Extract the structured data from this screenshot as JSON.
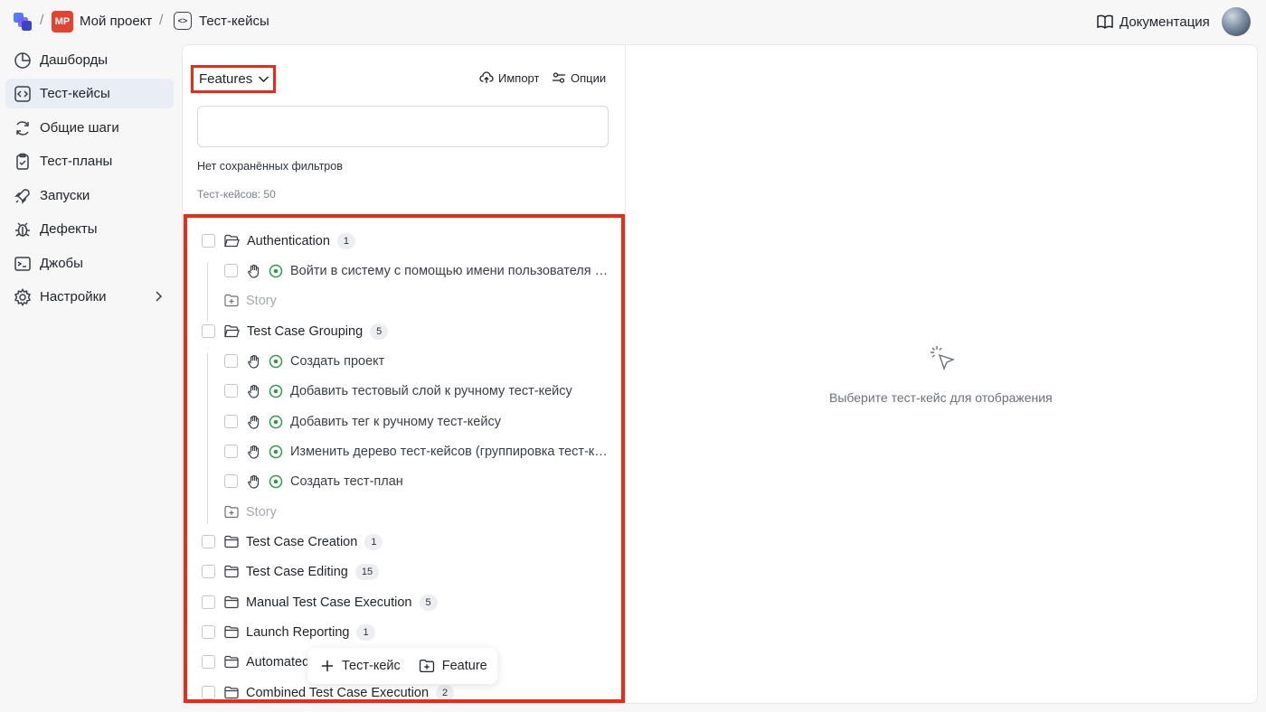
{
  "breadcrumb": {
    "separator": "/",
    "project_badge": "MP",
    "project_name": "Мой проект",
    "page_name": "Тест-кейсы"
  },
  "header": {
    "docs_label": "Документация"
  },
  "sidebar": {
    "items": [
      {
        "label": "Дашборды",
        "icon": "pie-chart-icon"
      },
      {
        "label": "Тест-кейсы",
        "icon": "code-square-icon",
        "active": true
      },
      {
        "label": "Общие шаги",
        "icon": "refresh-icon"
      },
      {
        "label": "Тест-планы",
        "icon": "clipboard-check-icon"
      },
      {
        "label": "Запуски",
        "icon": "rocket-icon"
      },
      {
        "label": "Дефекты",
        "icon": "bug-icon"
      },
      {
        "label": "Джобы",
        "icon": "terminal-icon"
      },
      {
        "label": "Настройки",
        "icon": "gear-icon"
      }
    ]
  },
  "panel": {
    "grouping_label": "Features",
    "import_label": "Импорт",
    "options_label": "Опции",
    "no_filters": "Нет сохранённых фильтров",
    "count_label": "Тест-кейсов: 50"
  },
  "tree": [
    {
      "type": "folder",
      "label": "Authentication",
      "count": "1",
      "open": true
    },
    {
      "type": "case",
      "label": "Войти в систему с помощью имени пользователя и пароля"
    },
    {
      "type": "story",
      "label": "Story"
    },
    {
      "type": "folder",
      "label": "Test Case Grouping",
      "count": "5",
      "open": true
    },
    {
      "type": "case",
      "label": "Создать проект"
    },
    {
      "type": "case",
      "label": "Добавить тестовый слой к ручному тест-кейсу"
    },
    {
      "type": "case",
      "label": "Добавить тег к ручному тест-кейсу"
    },
    {
      "type": "case",
      "label": "Изменить дерево тест-кейсов (группировка тест-кейсов)"
    },
    {
      "type": "case",
      "label": "Создать тест-план"
    },
    {
      "type": "story",
      "label": "Story"
    },
    {
      "type": "folder",
      "label": "Test Case Creation",
      "count": "1"
    },
    {
      "type": "folder",
      "label": "Test Case Editing",
      "count": "15"
    },
    {
      "type": "folder",
      "label": "Manual Test Case Execution",
      "count": "5"
    },
    {
      "type": "folder",
      "label": "Launch Reporting",
      "count": "1"
    },
    {
      "type": "folder",
      "label": "Automated",
      "count": ""
    },
    {
      "type": "folder",
      "label": "Combined Test Case Execution",
      "count": "2"
    }
  ],
  "floating": {
    "add_case_label": "Тест-кейс",
    "add_feature_label": "Feature"
  },
  "detail": {
    "empty_text": "Выберите тест-кейс для отображения"
  },
  "colors": {
    "highlight": "#ee2a14",
    "project_badge": "#e5432f",
    "status_green": "#2e9b4a",
    "active_nav": "#e9edf5"
  }
}
